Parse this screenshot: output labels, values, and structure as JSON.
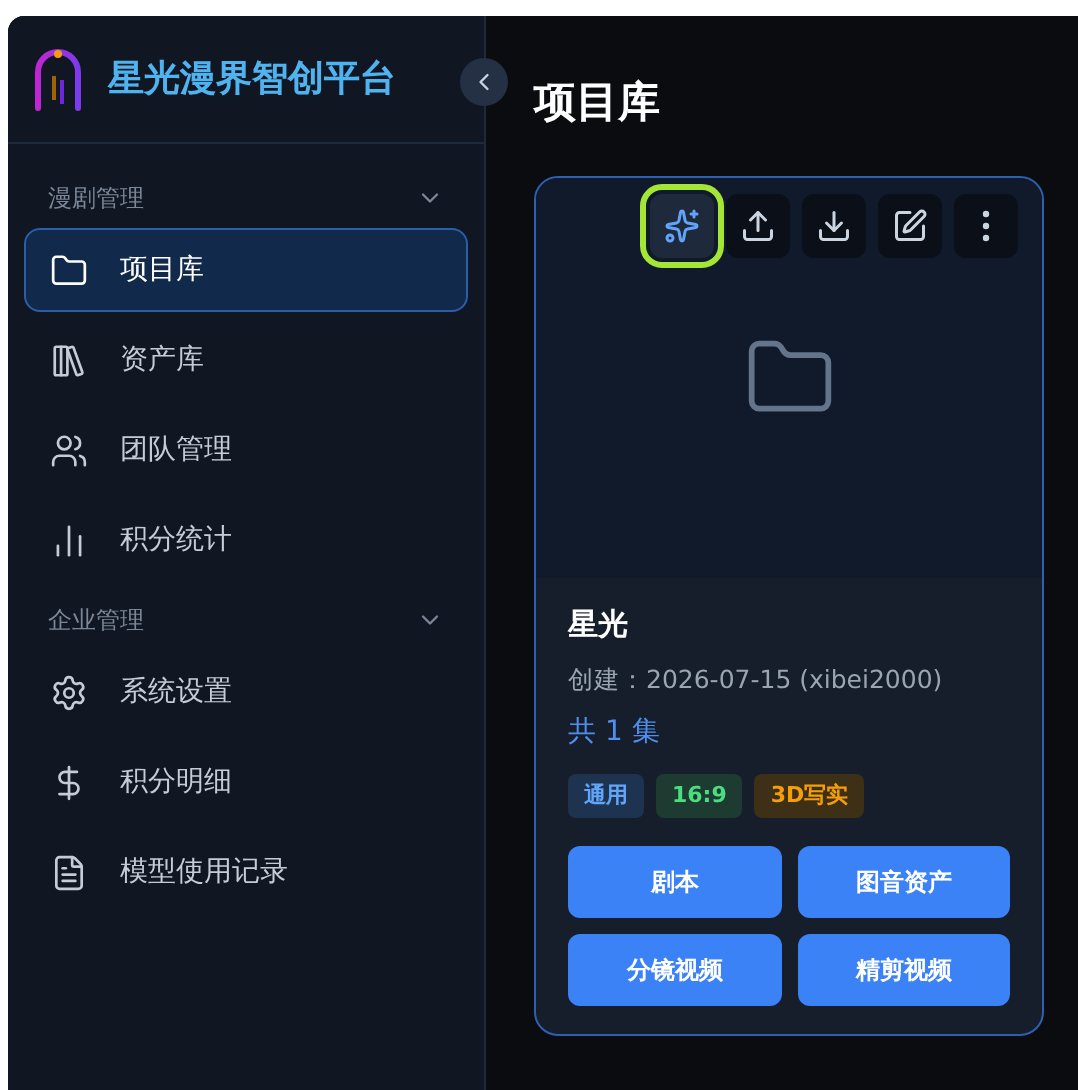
{
  "brand": {
    "title": "星光漫界智创平台"
  },
  "sidebar": {
    "groups": [
      {
        "label": "漫剧管理",
        "expanded": true,
        "items": [
          {
            "label": "项目库",
            "selected": true
          },
          {
            "label": "资产库",
            "selected": false
          },
          {
            "label": "团队管理",
            "selected": false
          },
          {
            "label": "积分统计",
            "selected": false
          }
        ]
      },
      {
        "label": "企业管理",
        "expanded": true,
        "items": [
          {
            "label": "系统设置",
            "selected": false
          },
          {
            "label": "积分明细",
            "selected": false
          },
          {
            "label": "模型使用记录",
            "selected": false
          }
        ]
      }
    ]
  },
  "page": {
    "title": "项目库"
  },
  "card": {
    "toolbar": [
      {
        "kind": "sparkle",
        "highlighted": true
      },
      {
        "kind": "upload",
        "highlighted": false
      },
      {
        "kind": "download",
        "highlighted": false
      },
      {
        "kind": "edit",
        "highlighted": false
      },
      {
        "kind": "more",
        "highlighted": false
      }
    ],
    "name": "星光",
    "created": "创建：2026-07-15 (xibei2000)",
    "episodes": "共 1 集",
    "tags": [
      {
        "label": "通用",
        "kind": "category"
      },
      {
        "label": "16:9",
        "kind": "ratio"
      },
      {
        "label": "3D写实",
        "kind": "style"
      }
    ],
    "actions": [
      "剧本",
      "图音资产",
      "分镜视频",
      "精剪视频"
    ]
  }
}
